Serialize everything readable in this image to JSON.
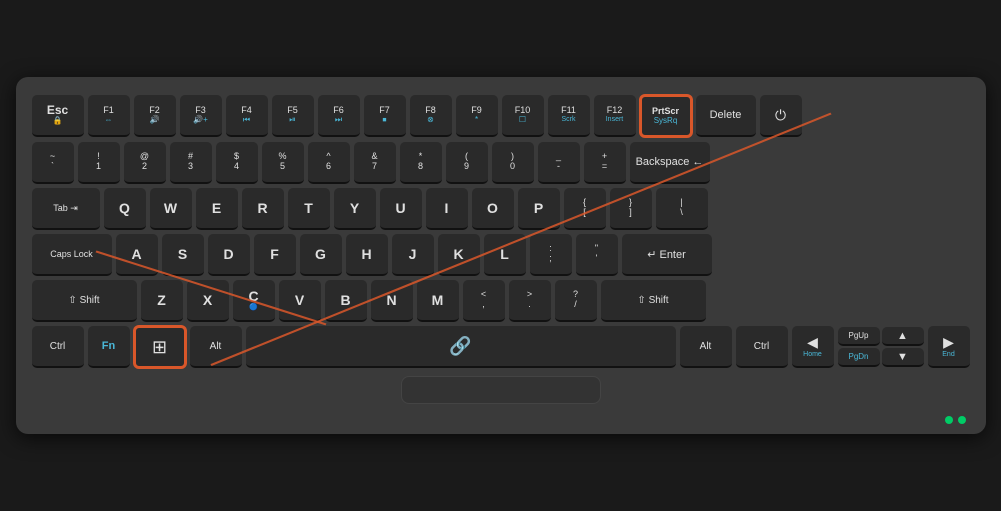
{
  "keyboard": {
    "highlighted_keys": [
      "PrtScr/SysRq",
      "Win",
      "CapsLock"
    ],
    "rows": {
      "fn_row": [
        "Esc",
        "F1",
        "F2",
        "F3",
        "F4",
        "F5",
        "F6",
        "F7",
        "F8",
        "F9",
        "F10",
        "F11",
        "F12",
        "PrtScr",
        "Delete",
        "Power"
      ],
      "number_row": [
        "~`",
        "!1",
        "@2",
        "#3",
        "$4",
        "%5",
        "^6",
        "&7",
        "*8",
        "(9",
        ")0",
        "-_",
        "+=",
        "Backspace"
      ],
      "qwerty_row": [
        "Tab",
        "Q",
        "W",
        "E",
        "R",
        "T",
        "Y",
        "U",
        "I",
        "O",
        "P",
        "{[",
        "}]",
        "\\|"
      ],
      "home_row": [
        "CapsLock",
        "A",
        "S",
        "D",
        "F",
        "G",
        "H",
        "J",
        "K",
        "L",
        ";:",
        "'\"",
        "Enter"
      ],
      "shift_row": [
        "Shift",
        "Z",
        "X",
        "C",
        "V",
        "B",
        "N",
        "M",
        "<,",
        ">.",
        "?/",
        "Shift"
      ],
      "bottom_row": [
        "Ctrl",
        "Fn",
        "Win",
        "Alt",
        "Space",
        "Alt",
        "Ctrl"
      ]
    }
  }
}
